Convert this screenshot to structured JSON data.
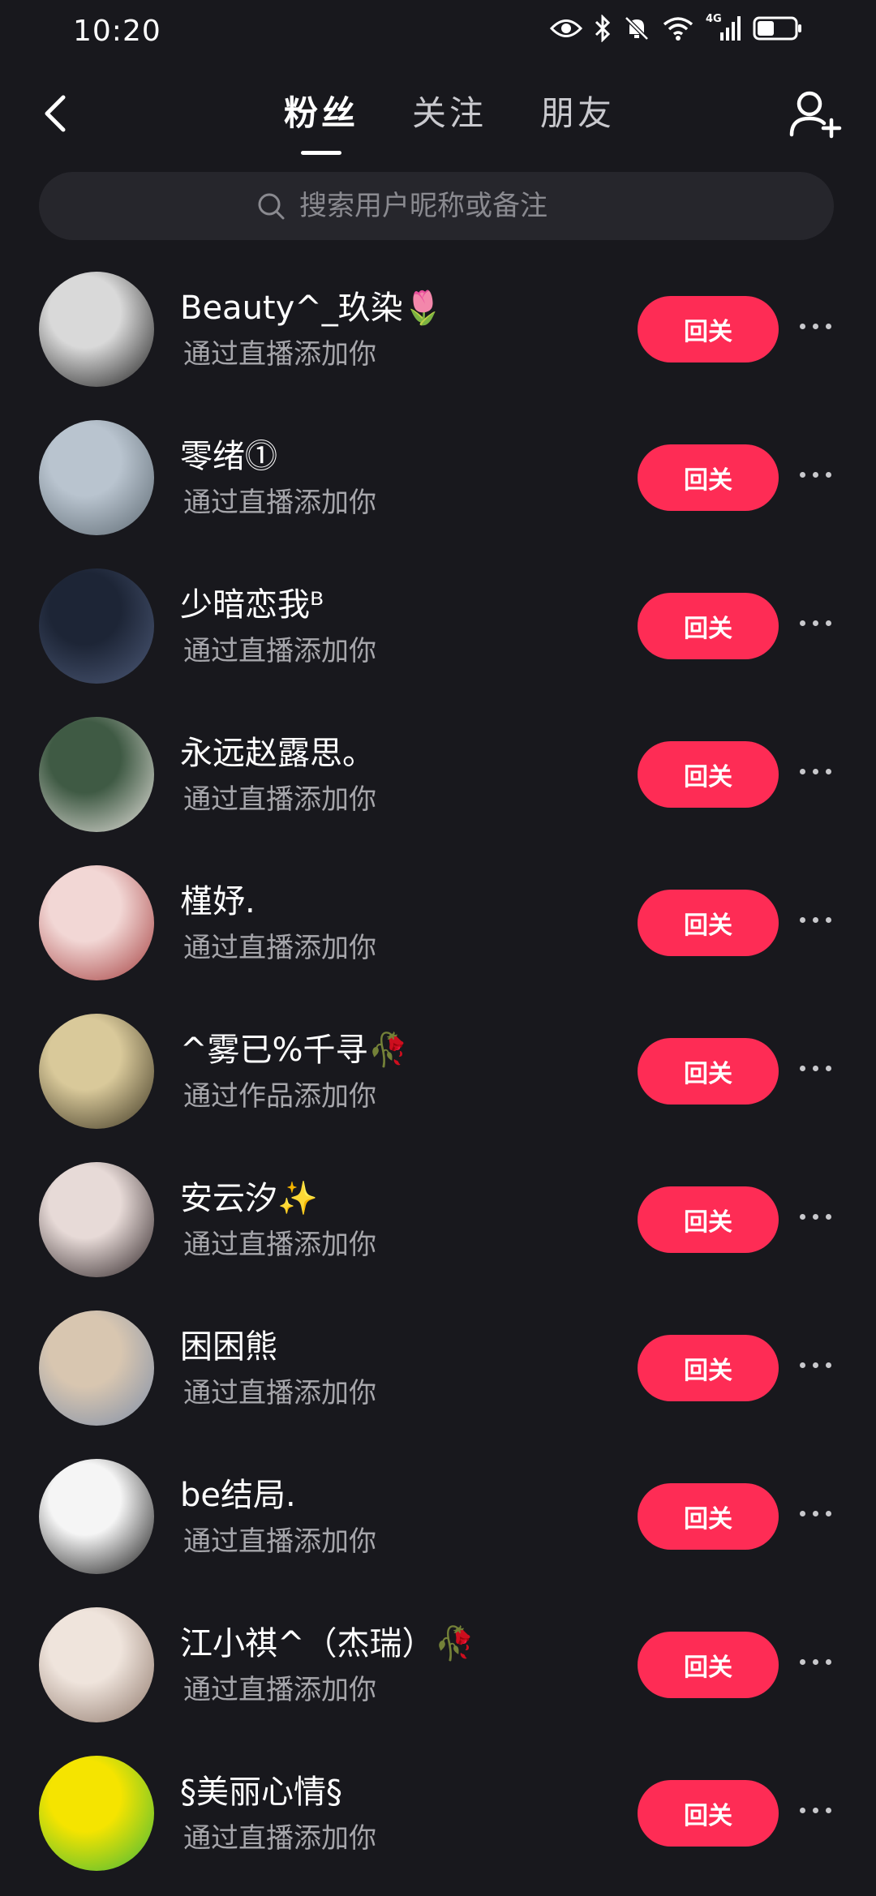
{
  "status_bar": {
    "time": "10:20",
    "network_label": "4G"
  },
  "nav": {
    "tabs": [
      {
        "label": "粉丝",
        "active": true
      },
      {
        "label": "关注",
        "active": false
      },
      {
        "label": "朋友",
        "active": false
      }
    ]
  },
  "search": {
    "placeholder": "搜索用户昵称或备注"
  },
  "accent_color": "#fe2c55",
  "followers": [
    {
      "name": "Beauty^_玖染🌷",
      "subtitle": "通过直播添加你",
      "button": "回关",
      "avatar_colors": [
        "#d9d9d9",
        "#1a1a1a"
      ]
    },
    {
      "name": "零绪⓵",
      "subtitle": "通过直播添加你",
      "button": "回关",
      "avatar_colors": [
        "#b9c4cf",
        "#5b6770"
      ]
    },
    {
      "name": "少暗恋我ᴮ",
      "subtitle": "通过直播添加你",
      "button": "回关",
      "avatar_colors": [
        "#1d2536",
        "#4d5a78"
      ]
    },
    {
      "name": "永远赵露思。",
      "subtitle": "通过直播添加你",
      "button": "回关",
      "avatar_colors": [
        "#3f5a44",
        "#e8e4df"
      ]
    },
    {
      "name": "槿妤.",
      "subtitle": "通过直播添加你",
      "button": "回关",
      "avatar_colors": [
        "#f2d7d5",
        "#a33b3b"
      ]
    },
    {
      "name": "^雾已%千寻🥀",
      "subtitle": "通过作品添加你",
      "button": "回关",
      "avatar_colors": [
        "#d9c99a",
        "#3a3320"
      ]
    },
    {
      "name": "安云汐✨",
      "subtitle": "通过直播添加你",
      "button": "回关",
      "avatar_colors": [
        "#e7dad7",
        "#2a2022"
      ]
    },
    {
      "name": "困困熊",
      "subtitle": "通过直播添加你",
      "button": "回关",
      "avatar_colors": [
        "#d8c6b0",
        "#7e8ea8"
      ]
    },
    {
      "name": "be结局.",
      "subtitle": "通过直播添加你",
      "button": "回关",
      "avatar_colors": [
        "#f5f5f5",
        "#111111"
      ]
    },
    {
      "name": "江小祺^（杰瑞）🥀",
      "subtitle": "通过直播添加你",
      "button": "回关",
      "avatar_colors": [
        "#efe4dc",
        "#8c7568"
      ]
    },
    {
      "name": "§美丽心情§",
      "subtitle": "通过直播添加你",
      "button": "回关",
      "avatar_colors": [
        "#f5e400",
        "#3cb83c"
      ]
    }
  ]
}
